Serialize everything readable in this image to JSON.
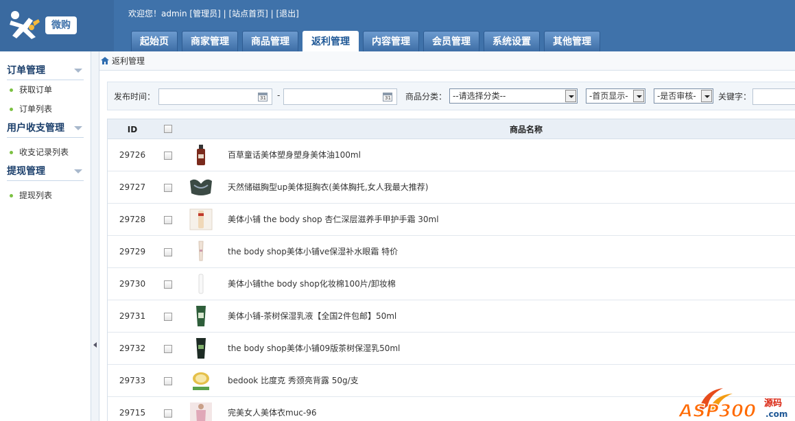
{
  "logo": {
    "tag": "微购"
  },
  "topbar": {
    "welcome": "欢迎您！admin [管理员] | [站点首页] | [退出]"
  },
  "tabs": [
    {
      "label": "起始页",
      "active": false
    },
    {
      "label": "商家管理",
      "active": false
    },
    {
      "label": "商品管理",
      "active": false
    },
    {
      "label": "返利管理",
      "active": true
    },
    {
      "label": "内容管理",
      "active": false
    },
    {
      "label": "会员管理",
      "active": false
    },
    {
      "label": "系统设置",
      "active": false
    },
    {
      "label": "其他管理",
      "active": false
    }
  ],
  "sidebar": {
    "groups": [
      {
        "title": "订单管理",
        "items": [
          "获取订单",
          "订单列表"
        ]
      },
      {
        "title": "用户收支管理",
        "items": [
          "收支记录列表"
        ]
      },
      {
        "title": "提现管理",
        "items": [
          "提现列表"
        ]
      }
    ]
  },
  "breadcrumb": "返利管理",
  "filter": {
    "publish_time_label": "发布时间：",
    "range_sep": "-",
    "date_icon_text": "31",
    "category_label": "商品分类：",
    "category_value": "--请选择分类--",
    "homepage_value": "-首页显示-",
    "audit_value": "-是否审核-",
    "keyword_label": "关键字："
  },
  "table": {
    "col_id": "ID",
    "col_name": "商品名称",
    "rows": [
      {
        "id": "29726",
        "name": "百草童话美体塑身塑身美体油100ml",
        "thumb": "bottle-dark"
      },
      {
        "id": "29727",
        "name": "天然储磁胸型up美体挺胸衣(美体胸托,女人我最大推荐)",
        "thumb": "bra"
      },
      {
        "id": "29728",
        "name": "美体小铺 the body shop 杏仁深层滋养手甲护手霜 30ml",
        "thumb": "tube-box"
      },
      {
        "id": "29729",
        "name": "the body shop美体小铺ve保湿补水眼霜 特价",
        "thumb": "tube-thin"
      },
      {
        "id": "29730",
        "name": "美体小铺the body shop化妆棉100片/卸妆棉",
        "thumb": "cotton"
      },
      {
        "id": "29731",
        "name": "美体小铺-茶树保湿乳液【全国2件包邮】50ml",
        "thumb": "tube-green"
      },
      {
        "id": "29732",
        "name": "the body shop美体小铺09版茶树保湿乳50ml",
        "thumb": "tube-black"
      },
      {
        "id": "29733",
        "name": "bedook 比度克 秀颈亮背露 50g/支",
        "thumb": "cream-jar"
      },
      {
        "id": "29715",
        "name": "完美女人美体衣muc-96",
        "thumb": "bodysuit"
      }
    ]
  },
  "watermark": {
    "text": "ASP300",
    "suffix": "源码",
    "domain": ".com"
  },
  "colors": {
    "header": "#3f72aa",
    "accent": "#1f5896",
    "bullet": "#7cc142"
  }
}
